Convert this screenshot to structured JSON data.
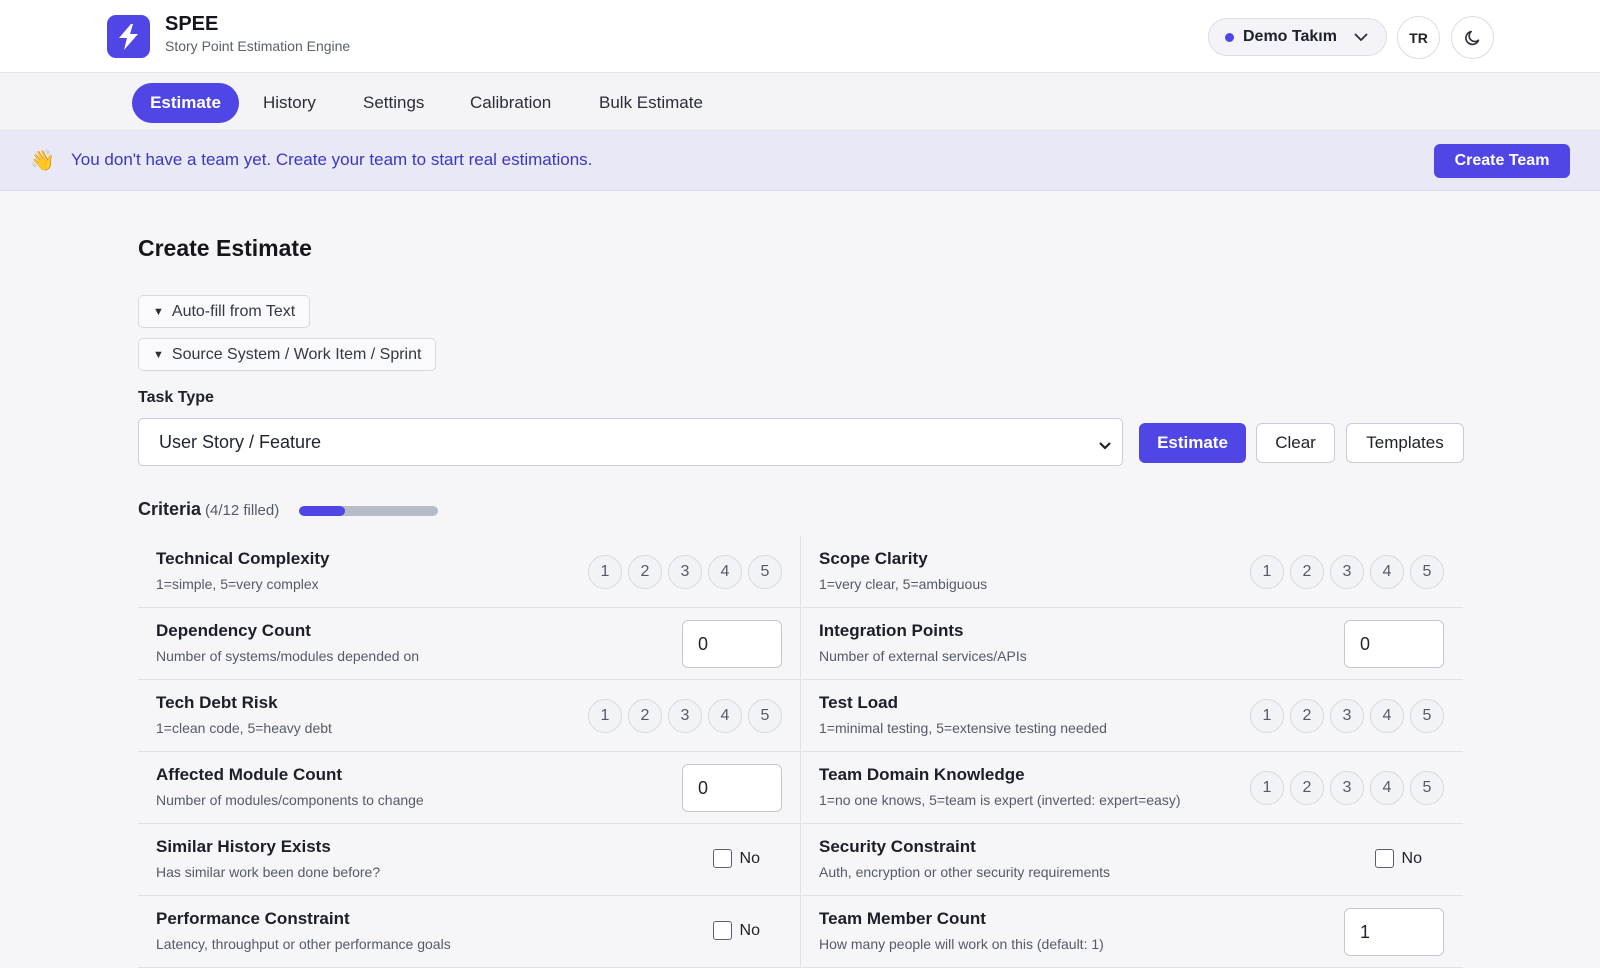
{
  "header": {
    "brand_title": "SPEE",
    "brand_subtitle": "Story Point Estimation Engine",
    "team_name": "Demo Takım",
    "lang_button": "TR",
    "theme_icon": "moon-icon",
    "logo_icon": "lightning-icon"
  },
  "tabs": [
    {
      "label": "Estimate",
      "active": true
    },
    {
      "label": "History",
      "active": false
    },
    {
      "label": "Settings",
      "active": false
    },
    {
      "label": "Calibration",
      "active": false
    },
    {
      "label": "Bulk Estimate",
      "active": false
    }
  ],
  "banner": {
    "icon": "👋",
    "text": "You don't have a team yet. Create your team to start real estimations.",
    "button": "Create Team"
  },
  "main": {
    "title": "Create Estimate",
    "autofill_label": "Auto-fill from Text",
    "source_label": "Source System / Work Item / Sprint",
    "task_type_label": "Task Type",
    "task_type_value": "User Story / Feature",
    "estimate_button": "Estimate",
    "clear_button": "Clear",
    "templates_button": "Templates"
  },
  "criteria": {
    "title": "Criteria",
    "count_text": "(4/12 filled)",
    "filled": 4,
    "total": 12,
    "scale_values": [
      "1",
      "2",
      "3",
      "4",
      "5"
    ],
    "rows": [
      {
        "left": {
          "title": "Technical Complexity",
          "desc": "1=simple, 5=very complex",
          "kind": "scale"
        },
        "right": {
          "title": "Scope Clarity",
          "desc": "1=very clear, 5=ambiguous",
          "kind": "scale"
        }
      },
      {
        "left": {
          "title": "Dependency Count",
          "desc": "Number of systems/modules depended on",
          "kind": "number",
          "value": "0"
        },
        "right": {
          "title": "Integration Points",
          "desc": "Number of external services/APIs",
          "kind": "number",
          "value": "0"
        }
      },
      {
        "left": {
          "title": "Tech Debt Risk",
          "desc": "1=clean code, 5=heavy debt",
          "kind": "scale"
        },
        "right": {
          "title": "Test Load",
          "desc": "1=minimal testing, 5=extensive testing needed",
          "kind": "scale"
        }
      },
      {
        "left": {
          "title": "Affected Module Count",
          "desc": "Number of modules/components to change",
          "kind": "number",
          "value": "0"
        },
        "right": {
          "title": "Team Domain Knowledge",
          "desc": "1=no one knows, 5=team is expert (inverted: expert=easy)",
          "kind": "scale"
        }
      },
      {
        "left": {
          "title": "Similar History Exists",
          "desc": "Has similar work been done before?",
          "kind": "check",
          "value": "No"
        },
        "right": {
          "title": "Security Constraint",
          "desc": "Auth, encryption or other security requirements",
          "kind": "check",
          "value": "No"
        }
      },
      {
        "left": {
          "title": "Performance Constraint",
          "desc": "Latency, throughput or other performance goals",
          "kind": "check",
          "value": "No"
        },
        "right": {
          "title": "Team Member Count",
          "desc": "How many people will work on this (default: 1)",
          "kind": "number",
          "value": "1"
        }
      }
    ]
  }
}
